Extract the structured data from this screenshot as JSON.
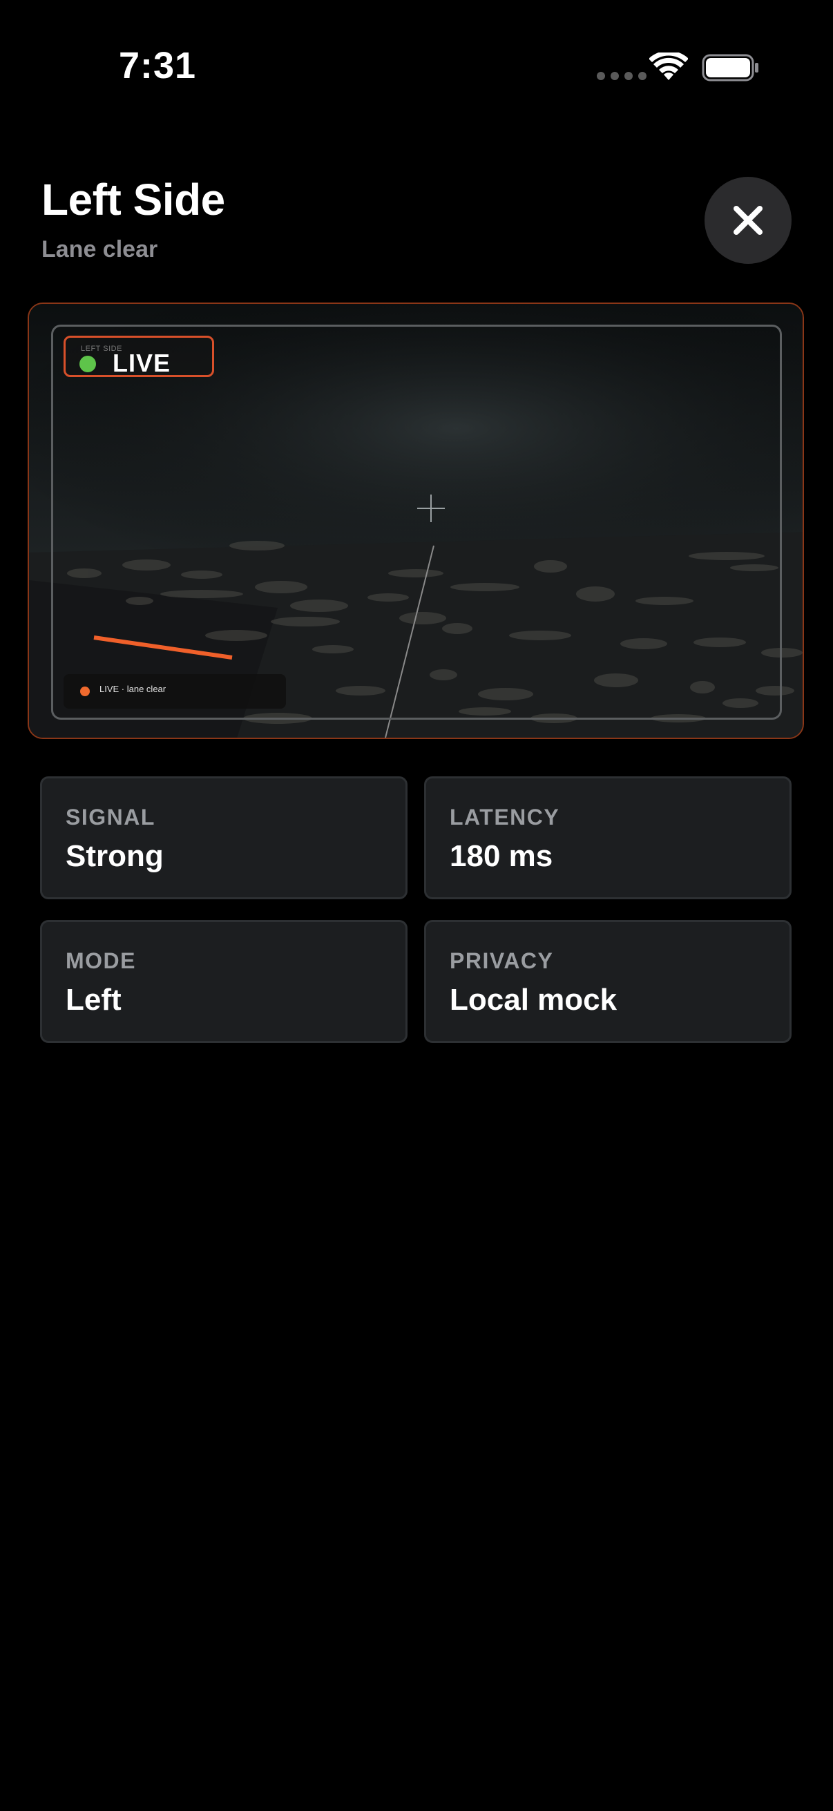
{
  "status_bar": {
    "time": "7:31"
  },
  "header": {
    "title": "Left Side",
    "subtitle": "Lane clear",
    "close_icon": "xmark-icon"
  },
  "camera": {
    "small_label": "LEFT SIDE",
    "live_label": "LIVE",
    "caption": "LIVE · lane clear",
    "accent_color": "#d8502a",
    "live_dot_color": "#5ec44a"
  },
  "stats": [
    {
      "label": "SIGNAL",
      "value": "Strong"
    },
    {
      "label": "LATENCY",
      "value": "180 ms"
    },
    {
      "label": "MODE",
      "value": "Left"
    },
    {
      "label": "PRIVACY",
      "value": "Local mock"
    }
  ]
}
